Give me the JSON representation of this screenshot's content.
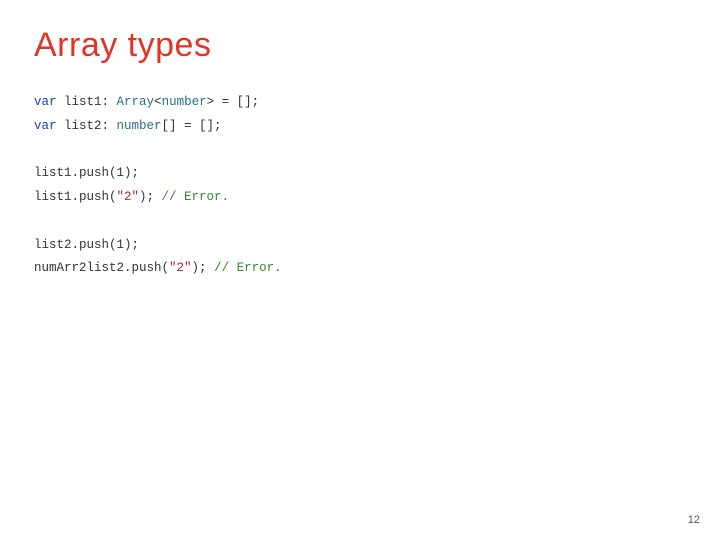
{
  "title": "Array types",
  "code": {
    "l1": {
      "kw": "var",
      "rest": " list1: ",
      "typ1": "Array",
      "lt": "<",
      "typ2": "number",
      "gt": "> = [];"
    },
    "l2": {
      "kw": "var",
      "rest": " list2: ",
      "typ": "number",
      "tail": "[] = [];"
    },
    "l3": "",
    "l4": "list1.push(1);",
    "l5": {
      "call": "list1.push(",
      "str": "\"2\"",
      "close": "); ",
      "cmt": "// Error."
    },
    "l6": "",
    "l7": "list2.push(1);",
    "l8": {
      "call": "numArr2list2.push(",
      "str": "\"2\"",
      "close": "); ",
      "cmt": "// Error."
    }
  },
  "pagenum": "12"
}
